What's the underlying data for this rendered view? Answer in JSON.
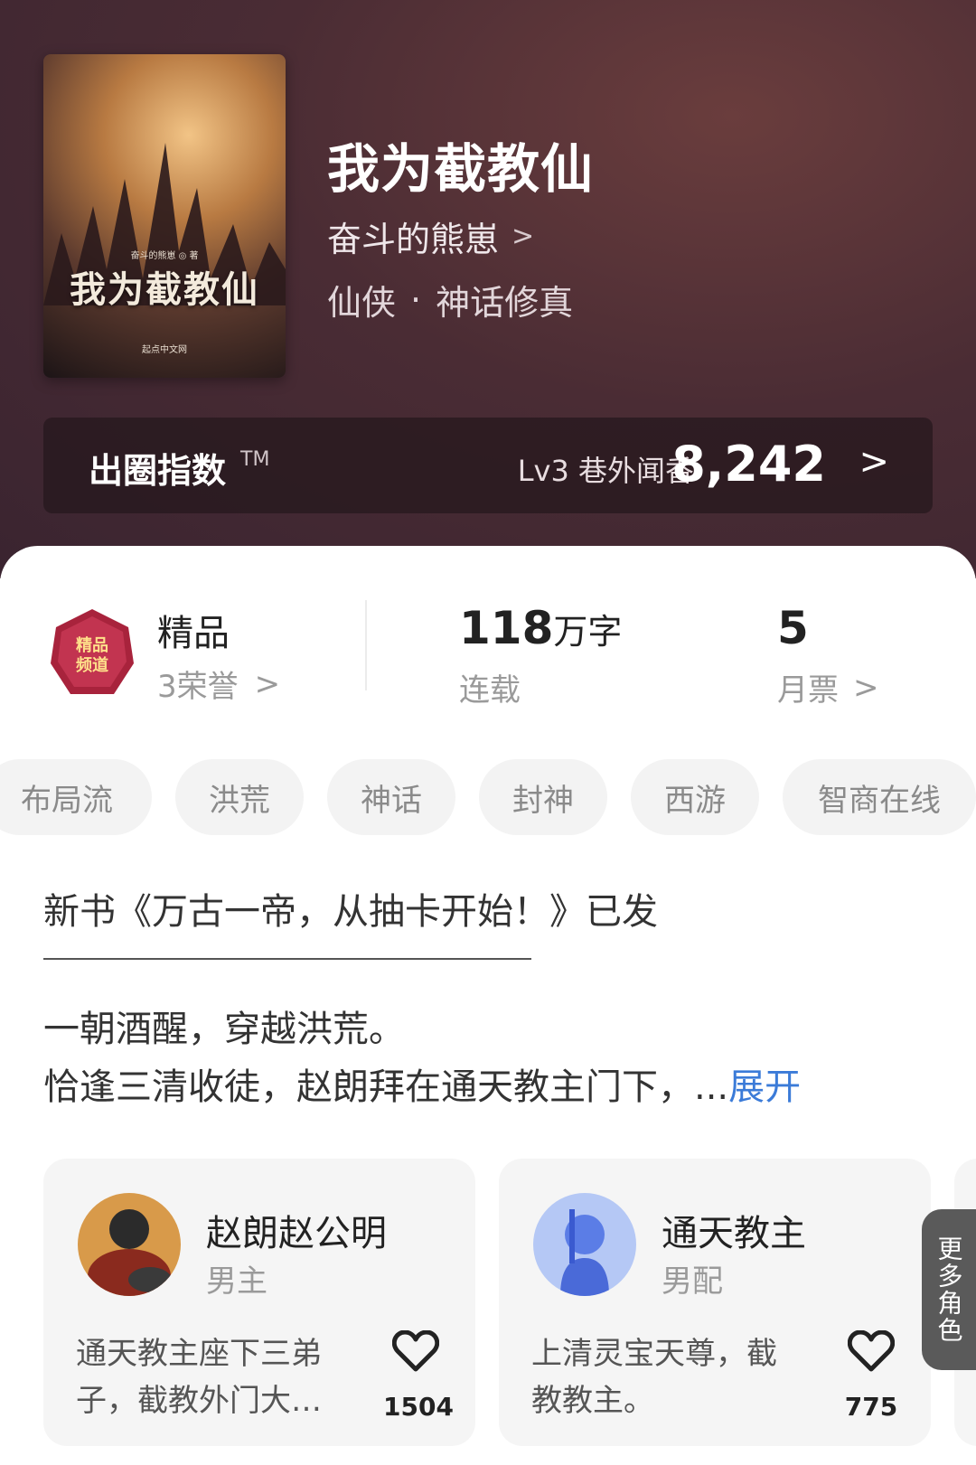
{
  "book": {
    "title": "我为截教仙",
    "author": "奋斗的熊崽",
    "genre_primary": "仙侠",
    "genre_secondary": "神话修真",
    "cover_title": "我为截教仙",
    "cover_author": "奋斗的熊崽 ◎ 著",
    "cover_publisher": "起点中文网"
  },
  "index": {
    "label": "出圈指数",
    "tm": "TM",
    "level": "Lv3 巷外闻香",
    "score": "8,242"
  },
  "stats": {
    "quality_label": "精品",
    "honors": "3荣誉",
    "words_number": "118",
    "words_unit": "万字",
    "status": "连载",
    "monthly_tickets": "5",
    "monthly_tickets_label": "月票"
  },
  "tags": [
    "布局流",
    "洪荒",
    "神话",
    "封神",
    "西游",
    "智商在线"
  ],
  "description": {
    "notice": "新书《万古一帝，从抽卡开始！》已发",
    "line1": "一朝酒醒，穿越洪荒。",
    "line2": "恰逢三清收徒，赵朗拜在通天教主门下，",
    "ellipsis": "...",
    "expand": "展开"
  },
  "characters": [
    {
      "name": "赵朗赵公明",
      "role": "男主",
      "desc": "通天教主座下三弟子，截教外门大…",
      "likes": "1504"
    },
    {
      "name": "通天教主",
      "role": "男配",
      "desc": "上清灵宝天尊，截教教主。",
      "likes": "775"
    }
  ],
  "more_roles": "更多角色",
  "colors": {
    "expand_link": "#3b7bd8",
    "hero_bg": "#4a2c34"
  }
}
